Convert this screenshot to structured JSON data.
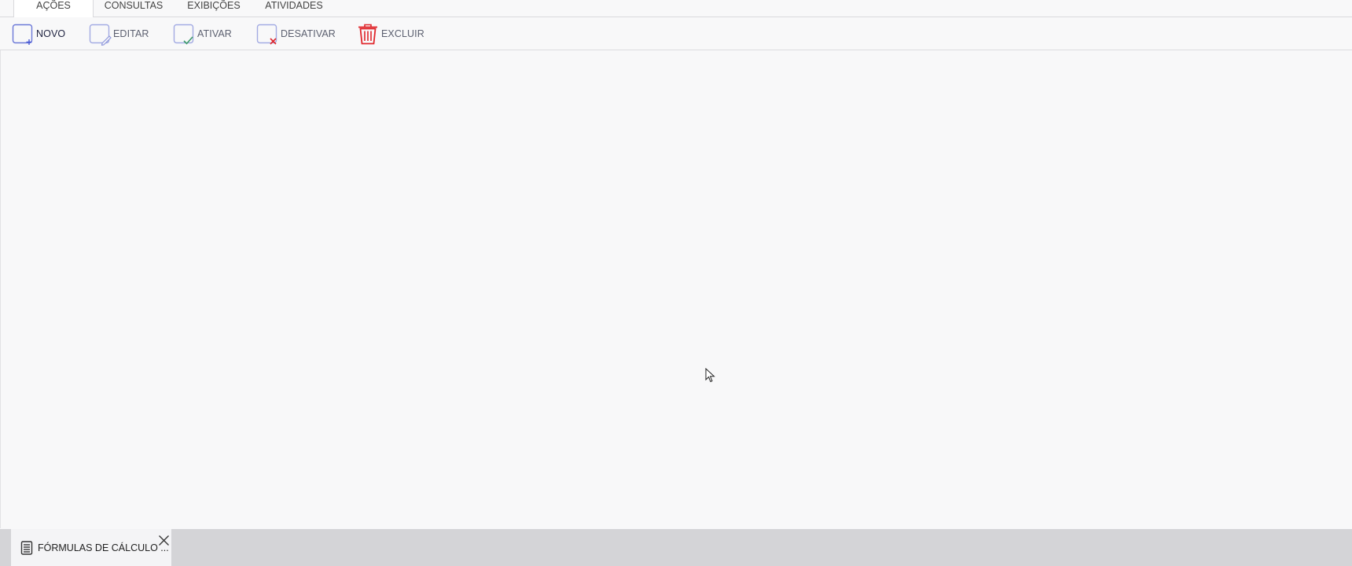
{
  "ribbon": {
    "tabs": [
      {
        "label": "AÇÕES",
        "active": true
      },
      {
        "label": "CONSULTAS",
        "active": false
      },
      {
        "label": "EXIBIÇÕES",
        "active": false
      },
      {
        "label": "ATIVIDADES",
        "active": false
      }
    ]
  },
  "toolbar": {
    "novo": {
      "label": "NOVO",
      "icon": "new-document-icon"
    },
    "editar": {
      "label": "EDITAR",
      "icon": "edit-document-icon"
    },
    "ativar": {
      "label": "ATIVAR",
      "icon": "activate-check-icon"
    },
    "desativar": {
      "label": "DESATIVAR",
      "icon": "deactivate-x-icon"
    },
    "excluir": {
      "label": "EXCLUIR",
      "icon": "trash-icon"
    }
  },
  "colors": {
    "accent": "#4a5bd6",
    "delete": "#e0262b",
    "check": "#3c9a6a"
  },
  "document_tabs": [
    {
      "label": "FÓRMULAS DE CÁLCULO ...",
      "icon": "document-list-icon"
    }
  ]
}
